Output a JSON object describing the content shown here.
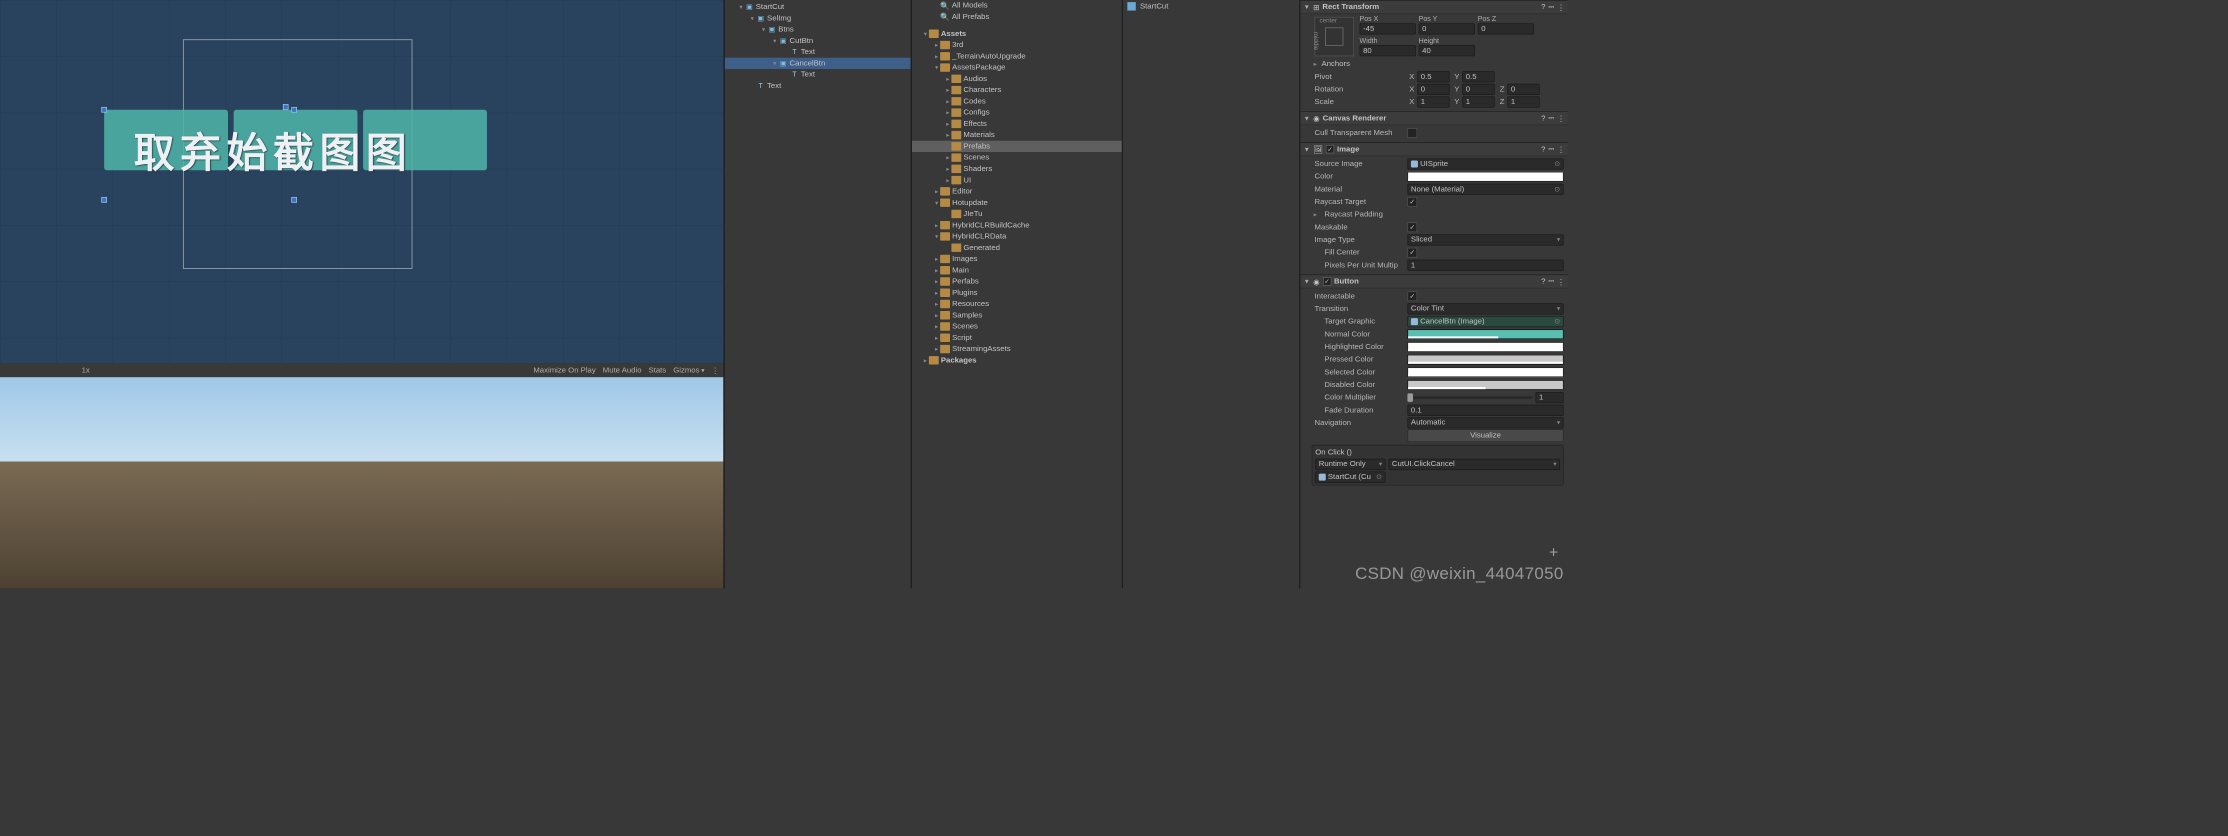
{
  "scene": {
    "zoom": "1x",
    "overlay_text": "取弃始截图图",
    "toolbar": {
      "maximize": "Maximize On Play",
      "mute": "Mute Audio",
      "stats": "Stats",
      "gizmos": "Gizmos"
    }
  },
  "hierarchy": [
    {
      "d": 0,
      "f": "▾",
      "i": "go",
      "t": "StartCut"
    },
    {
      "d": 1,
      "f": "▾",
      "i": "go",
      "t": "SelImg"
    },
    {
      "d": 2,
      "f": "▾",
      "i": "go",
      "t": "Btns"
    },
    {
      "d": 3,
      "f": "▾",
      "i": "go",
      "t": "CutBtn"
    },
    {
      "d": 4,
      "f": "",
      "i": "txt",
      "t": "Text"
    },
    {
      "d": 3,
      "f": "▾",
      "i": "go",
      "t": "CancelBtn",
      "sel": true
    },
    {
      "d": 4,
      "f": "",
      "i": "txt",
      "t": "Text"
    },
    {
      "d": 1,
      "f": "",
      "i": "txt",
      "t": "Text"
    }
  ],
  "project": {
    "top": [
      {
        "d": 1,
        "f": "",
        "i": "sr",
        "t": "All Models"
      },
      {
        "d": 1,
        "f": "",
        "i": "sr",
        "t": "All Prefabs"
      }
    ],
    "tree": [
      {
        "d": 0,
        "f": "▾",
        "t": "Assets",
        "bold": true
      },
      {
        "d": 1,
        "f": "▸",
        "t": "3rd"
      },
      {
        "d": 1,
        "f": "▸",
        "t": "_TerrainAutoUpgrade"
      },
      {
        "d": 1,
        "f": "▾",
        "t": "AssetsPackage"
      },
      {
        "d": 2,
        "f": "▸",
        "t": "Audios"
      },
      {
        "d": 2,
        "f": "▸",
        "t": "Characters"
      },
      {
        "d": 2,
        "f": "▸",
        "t": "Codes"
      },
      {
        "d": 2,
        "f": "▸",
        "t": "Configs"
      },
      {
        "d": 2,
        "f": "▸",
        "t": "Effects"
      },
      {
        "d": 2,
        "f": "▸",
        "t": "Materials"
      },
      {
        "d": 2,
        "f": "",
        "t": "Prefabs",
        "sel": true
      },
      {
        "d": 2,
        "f": "▸",
        "t": "Scenes"
      },
      {
        "d": 2,
        "f": "▸",
        "t": "Shaders"
      },
      {
        "d": 2,
        "f": "▸",
        "t": "UI"
      },
      {
        "d": 1,
        "f": "▸",
        "t": "Editor"
      },
      {
        "d": 1,
        "f": "▾",
        "t": "Hotupdate"
      },
      {
        "d": 2,
        "f": "",
        "t": "JIeTu"
      },
      {
        "d": 1,
        "f": "▸",
        "t": "HybridCLRBuildCache"
      },
      {
        "d": 1,
        "f": "▾",
        "t": "HybridCLRData"
      },
      {
        "d": 2,
        "f": "",
        "t": "Generated"
      },
      {
        "d": 1,
        "f": "▸",
        "t": "Images"
      },
      {
        "d": 1,
        "f": "▸",
        "t": "Main"
      },
      {
        "d": 1,
        "f": "▸",
        "t": "Perfabs"
      },
      {
        "d": 1,
        "f": "▸",
        "t": "Plugins"
      },
      {
        "d": 1,
        "f": "▸",
        "t": "Resources"
      },
      {
        "d": 1,
        "f": "▸",
        "t": "Samples"
      },
      {
        "d": 1,
        "f": "▸",
        "t": "Scenes"
      },
      {
        "d": 1,
        "f": "▸",
        "t": "Script"
      },
      {
        "d": 1,
        "f": "▸",
        "t": "StreamingAssets"
      },
      {
        "d": 0,
        "f": "▸",
        "t": "Packages",
        "bold": true
      }
    ]
  },
  "breadcrumb": "StartCut",
  "inspector": {
    "rect": {
      "title": "Rect Transform",
      "anchor_h": "center",
      "anchor_v": "middle",
      "posx_l": "Pos X",
      "posy_l": "Pos Y",
      "posz_l": "Pos Z",
      "posx": "-45",
      "posy": "0",
      "posz": "0",
      "w_l": "Width",
      "h_l": "Height",
      "w": "80",
      "h": "40",
      "anchors": "Anchors",
      "pivot_l": "Pivot",
      "pivx": "0.5",
      "pivy": "0.5",
      "rot_l": "Rotation",
      "rx": "0",
      "ry": "0",
      "rz": "0",
      "scale_l": "Scale",
      "sx": "1",
      "sy": "1",
      "sz": "1"
    },
    "canvasrend": {
      "title": "Canvas Renderer",
      "cull": "Cull Transparent Mesh"
    },
    "image": {
      "title": "Image",
      "src_l": "Source Image",
      "src": "UISprite",
      "color_l": "Color",
      "mat_l": "Material",
      "mat": "None (Material)",
      "rt_l": "Raycast Target",
      "rp_l": "Raycast Padding",
      "mk_l": "Maskable",
      "it_l": "Image Type",
      "it": "Sliced",
      "fc_l": "Fill Center",
      "ppu_l": "Pixels Per Unit Multip",
      "ppu": "1"
    },
    "button": {
      "title": "Button",
      "inter_l": "Interactable",
      "trans_l": "Transition",
      "trans": "Color Tint",
      "tg_l": "Target Graphic",
      "tg": "CancelBtn (Image)",
      "nc_l": "Normal Color",
      "hc_l": "Highlighted Color",
      "pc_l": "Pressed Color",
      "sc_l": "Selected Color",
      "dc_l": "Disabled Color",
      "cm_l": "Color Multiplier",
      "cm": "1",
      "fd_l": "Fade Duration",
      "fd": "0.1",
      "nav_l": "Navigation",
      "nav": "Automatic",
      "vis": "Visualize",
      "onclick": "On Click ()",
      "runtime": "Runtime Only",
      "func": "CutUI.ClickCancel",
      "obj": "StartCut (Cu"
    }
  },
  "watermark": "CSDN @weixin_44047050"
}
